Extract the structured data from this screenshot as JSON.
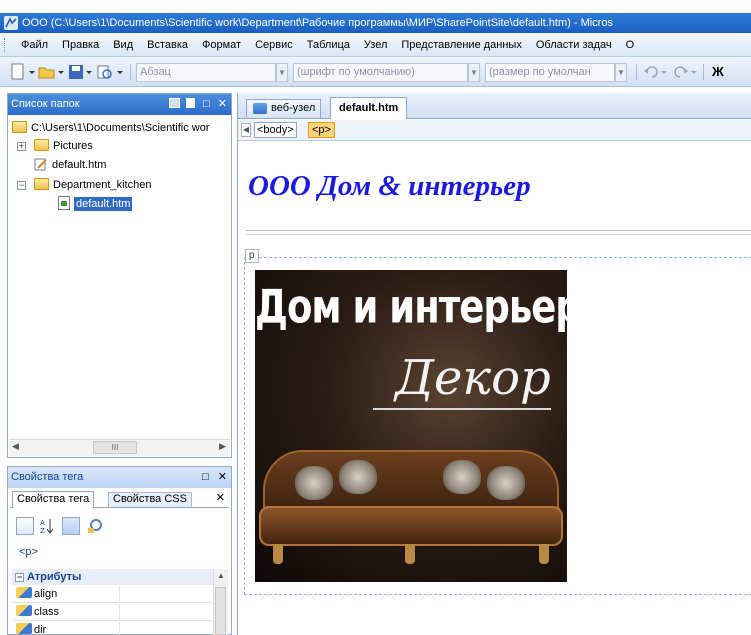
{
  "window": {
    "title": "ООО (C:\\Users\\1\\Documents\\Scientific work\\Department\\Рабочие программы\\МИР\\SharePointSite\\default.htm) - Micros"
  },
  "menu": {
    "items": [
      "Файл",
      "Правка",
      "Вид",
      "Вставка",
      "Формат",
      "Сервис",
      "Таблица",
      "Узел",
      "Представление данных",
      "Области задач",
      "О"
    ]
  },
  "toolbar": {
    "style_value": "Абзац",
    "font_value": "(шрифт по умолчанию)",
    "size_value": "(размер по умолчан",
    "bold_label": "Ж"
  },
  "folder_panel": {
    "title": "Список папок",
    "root_path": "C:\\Users\\1\\Documents\\Scientific wor",
    "items": [
      {
        "label": "Pictures"
      },
      {
        "label": "default.htm"
      },
      {
        "label": "Department_kitchen"
      },
      {
        "label": "default.htm"
      }
    ],
    "scroll_grip": "III"
  },
  "tag_panel": {
    "title": "Свойства тега",
    "tabs": [
      "Свойства тега",
      "Свойства CSS"
    ],
    "current_tag": "<p>",
    "attributes_header": "Атрибуты",
    "attributes": [
      "align",
      "class",
      "dir"
    ]
  },
  "editor": {
    "tabs": [
      "веб-узел",
      "default.htm"
    ],
    "breadcrumbs": [
      "<body>",
      "<p>"
    ],
    "heading": "ООО Дом &  интерьер",
    "paragraph_tag": "p",
    "picture": {
      "title": "Дом и интерьер",
      "script": "Декор"
    }
  },
  "colors": {
    "titlebar": "#1b5fc0",
    "heading": "#1a1ae0",
    "selection": "#316ac5"
  }
}
